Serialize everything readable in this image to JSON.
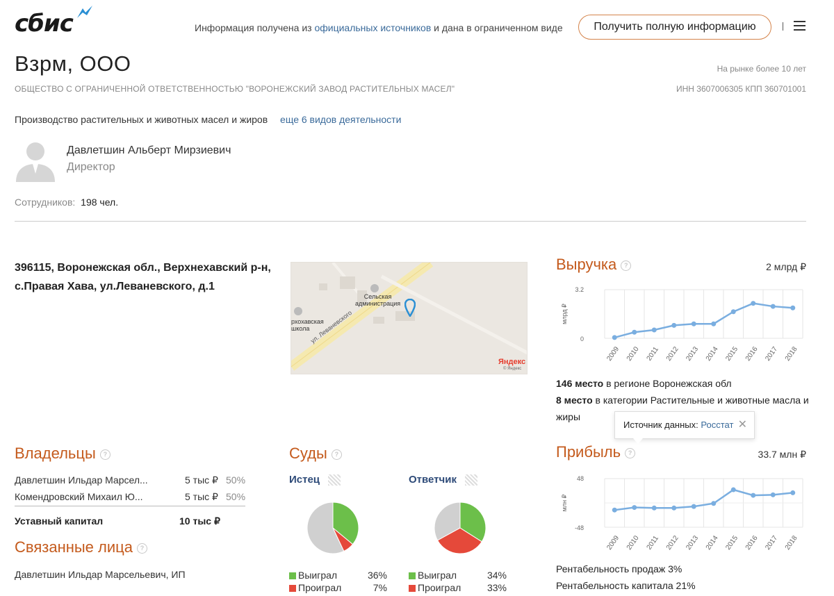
{
  "brand": {
    "logo_text": "сбис"
  },
  "header": {
    "info_prefix": "Информация получена из",
    "info_link": "официальных источников",
    "info_suffix": "и дана в ограниченном виде",
    "full_button": "Получить полную информацию"
  },
  "company": {
    "title": "Взрм, ООО",
    "full_name": "ОБЩЕСТВО С ОГРАНИЧЕННОЙ ОТВЕТСТВЕННОСТЬЮ \"ВОРОНЕЖСКИЙ ЗАВОД РАСТИТЕЛЬНЫХ МАСЕЛ\"",
    "market": "На рынке более 10 лет",
    "inn": "ИНН 3607006305  КПП 360701001",
    "activity": "Производство растительных и животных масел и жиров",
    "activity_more": "еще 6 видов деятельности",
    "director_name": "Давлетшин Альберт Мирзиевич",
    "director_role": "Директор",
    "employees_label": "Сотрудников:",
    "employees_value": "198 чел.",
    "address": "396115, Воронежская обл., Верхнехавский р-н, с.Правая Хава, ул.Леваневского, д.1"
  },
  "map": {
    "label_admin": "Сельская\nадминистрация",
    "label_school": "рхохавская\nшкола",
    "street": "ул. Леваневского",
    "logo": "Яндекс",
    "copyright": "© Яндекс"
  },
  "revenue": {
    "title": "Выручка",
    "amount": "2 млрд ₽",
    "rank_region_num": "146 место",
    "rank_region_text": "в регионе Воронежская обл",
    "rank_cat_num": "8 место",
    "rank_cat_text": "в категории Растительные и животные масла и жиры"
  },
  "tooltip": {
    "label": "Источник данных:",
    "link": "Росстат",
    "close": "✕"
  },
  "profit": {
    "title": "Прибыль",
    "amount": "33.7 млн ₽",
    "sales_profitability": "Рентабельность продаж 3%",
    "capital_profitability": "Рентабельность капитала 21%"
  },
  "owners": {
    "title": "Владельцы",
    "rows": [
      {
        "name": "Давлетшин Ильдар Марсел...",
        "amount": "5 тыс ₽",
        "share": "50%"
      },
      {
        "name": "Комендровский Михаил Ю...",
        "amount": "5 тыс ₽",
        "share": "50%"
      }
    ],
    "capital_label": "Уставный капитал",
    "capital_value": "10 тыс ₽"
  },
  "related": {
    "title": "Связанные лица",
    "items": [
      "Давлетшин Ильдар Марсельевич, ИП"
    ]
  },
  "courts": {
    "title": "Суды",
    "plaintiff_label": "Истец",
    "defendant_label": "Ответчик",
    "won_label": "Выиграл",
    "lost_label": "Проиграл",
    "plaintiff_won": "36%",
    "plaintiff_lost": "7%",
    "defendant_won": "34%",
    "defendant_lost": "33%"
  },
  "colors": {
    "accent": "#c45a1c",
    "line": "#7aaee0",
    "won": "#6cbf4a",
    "lost": "#e5493a",
    "other": "#d0d0d0"
  },
  "chart_data": [
    {
      "type": "line",
      "name": "Выручка",
      "ylabel": "млрд ₽",
      "x": [
        "2009",
        "2010",
        "2011",
        "2012",
        "2013",
        "2014",
        "2015",
        "2016",
        "2017",
        "2018"
      ],
      "values": [
        0.05,
        0.4,
        0.55,
        0.85,
        0.95,
        0.95,
        1.75,
        2.3,
        2.1,
        2.0
      ],
      "yticks": [
        "0",
        "3.2"
      ],
      "ylim": [
        0,
        3.2
      ],
      "grid": true
    },
    {
      "type": "line",
      "name": "Прибыль",
      "ylabel": "млн ₽",
      "x": [
        "2009",
        "2010",
        "2011",
        "2012",
        "2013",
        "2014",
        "2015",
        "2016",
        "2017",
        "2018"
      ],
      "values": [
        -14,
        -9,
        -10,
        -10,
        -7,
        -1,
        26,
        15,
        16,
        20
      ],
      "yticks": [
        "-48",
        "48"
      ],
      "ylim": [
        -48,
        48
      ],
      "grid": true
    },
    {
      "type": "pie",
      "name": "Истец",
      "labels": [
        "Выиграл",
        "Проиграл",
        "Прочее"
      ],
      "values": [
        36,
        7,
        57
      ]
    },
    {
      "type": "pie",
      "name": "Ответчик",
      "labels": [
        "Выиграл",
        "Проиграл",
        "Прочее"
      ],
      "values": [
        34,
        33,
        33
      ]
    }
  ]
}
